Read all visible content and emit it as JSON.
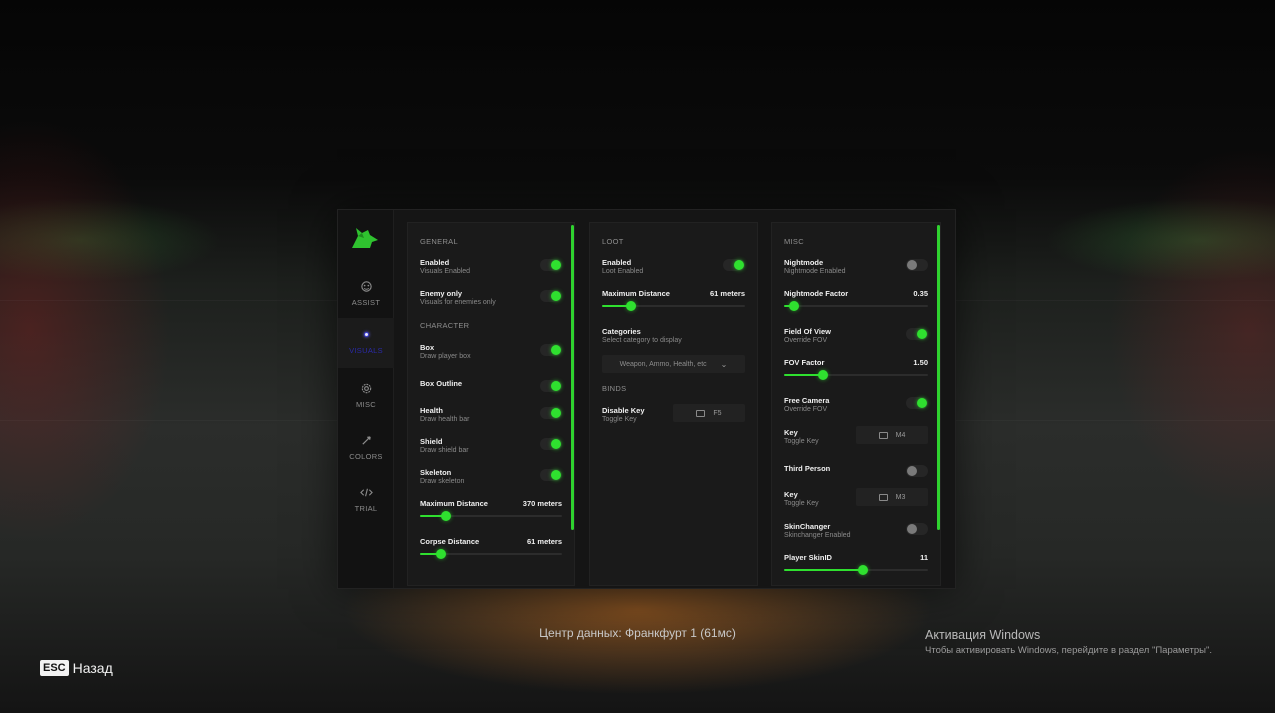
{
  "sidebar": {
    "items": [
      {
        "label": "ASSIST",
        "icon": "crosshair-icon"
      },
      {
        "label": "VISUALS",
        "icon": "dot-icon",
        "active": true
      },
      {
        "label": "MISC",
        "icon": "gear-icon"
      },
      {
        "label": "COLORS",
        "icon": "pipette-icon"
      },
      {
        "label": "TRIAL",
        "icon": "code-icon"
      }
    ]
  },
  "visuals": {
    "general_header": "GENERAL",
    "enabled": {
      "title": "Enabled",
      "sub": "Visuals Enabled",
      "on": true
    },
    "enemy_only": {
      "title": "Enemy only",
      "sub": "Visuals for enemies only",
      "on": true
    },
    "character_header": "CHARACTER",
    "box": {
      "title": "Box",
      "sub": "Draw player box",
      "on": true
    },
    "box_outline": {
      "title": "Box Outline",
      "on": true
    },
    "health": {
      "title": "Health",
      "sub": "Draw health bar",
      "on": true
    },
    "shield": {
      "title": "Shield",
      "sub": "Draw shield bar",
      "on": true
    },
    "skeleton": {
      "title": "Skeleton",
      "sub": "Draw skeleton",
      "on": true
    },
    "max_distance": {
      "title": "Maximum Distance",
      "value": "370 meters",
      "fraction": 0.18
    },
    "corpse_distance": {
      "title": "Corpse Distance",
      "value": "61 meters",
      "fraction": 0.15
    }
  },
  "loot": {
    "header": "LOOT",
    "enabled": {
      "title": "Enabled",
      "sub": "Loot Enabled",
      "on": true
    },
    "max_distance": {
      "title": "Maximum Distance",
      "value": "61 meters",
      "fraction": 0.2
    },
    "categories": {
      "title": "Categories",
      "sub": "Select category to display",
      "selected": "Weapon, Ammo, Health, etc"
    },
    "binds_header": "BINDS",
    "disable_key": {
      "title": "Disable Key",
      "sub": "Toggle Key",
      "key": "F5"
    }
  },
  "misc": {
    "header": "MISC",
    "nightmode": {
      "title": "Nightmode",
      "sub": "Nightmode Enabled",
      "on": false
    },
    "nightmode_factor": {
      "title": "Nightmode Factor",
      "value": "0.35",
      "fraction": 0.07
    },
    "fov": {
      "title": "Field Of View",
      "sub": "Override FOV",
      "on": true
    },
    "fov_factor": {
      "title": "FOV Factor",
      "value": "1.50",
      "fraction": 0.27
    },
    "free_camera": {
      "title": "Free Camera",
      "sub": "Override FOV",
      "on": true
    },
    "free_camera_key": {
      "title": "Key",
      "sub": "Toggle Key",
      "key": "M4"
    },
    "third_person": {
      "title": "Third Person",
      "on": false
    },
    "third_person_key": {
      "title": "Key",
      "sub": "Toggle Key",
      "key": "M3"
    },
    "skinchanger": {
      "title": "SkinChanger",
      "sub": "Skinchanger Enabled",
      "on": false
    },
    "skin_id": {
      "title": "Player SkinID",
      "value": "11",
      "fraction": 0.55
    }
  },
  "footer": {
    "datacenter": "Центр данных: Франкфурт 1 (61мс)",
    "esc_key": "ESC",
    "back_label": "Назад"
  },
  "windows_activation": {
    "title": "Активация Windows",
    "subtitle": "Чтобы активировать Windows, перейдите в раздел \"Параметры\"."
  },
  "colors": {
    "accent": "#2fe02f",
    "panel": "#151515",
    "active_nav": "#2a2aa8"
  }
}
